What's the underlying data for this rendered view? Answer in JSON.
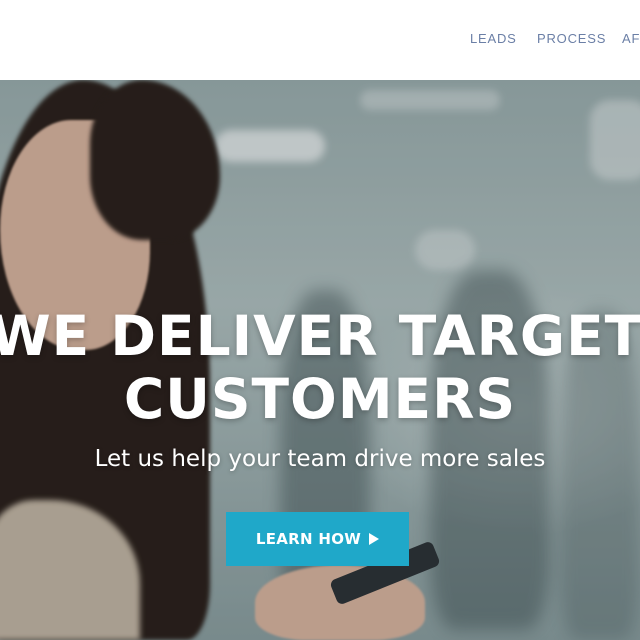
{
  "nav": {
    "items": [
      "LEADS",
      "PROCESS",
      "AF"
    ]
  },
  "hero": {
    "headline_line1": "WE DELIVER TARGETED",
    "headline_line2": "CUSTOMERS",
    "subheadline": "Let us help your team drive more sales",
    "cta_label": "LEARN HOW"
  },
  "colors": {
    "nav_link": "#6b7fa6",
    "cta_background": "#1fa8c9",
    "hero_text": "#ffffff"
  },
  "icons": {
    "cta_icon": "play-icon"
  }
}
